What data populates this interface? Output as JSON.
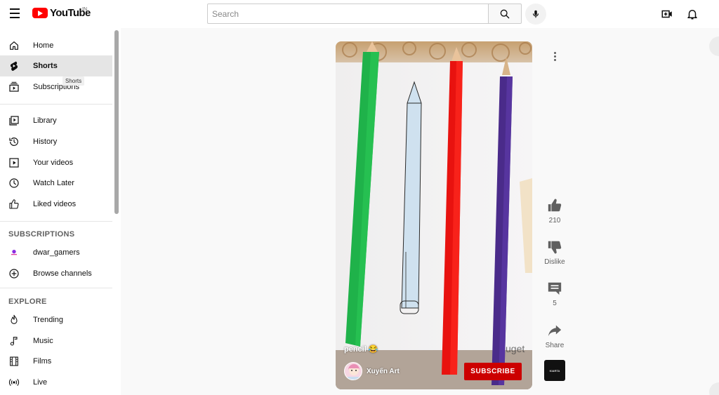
{
  "header": {
    "menu_icon": "hamburger-icon",
    "logo_text": "YouTube",
    "country_code": "IN",
    "search_placeholder": "Search",
    "search_icon": "search-icon",
    "mic_icon": "mic-icon",
    "create_icon": "create-video-icon",
    "notifications_icon": "bell-icon"
  },
  "sidebar": {
    "main": [
      {
        "label": "Home",
        "icon": "home-icon"
      },
      {
        "label": "Shorts",
        "icon": "shorts-icon",
        "active": true
      },
      {
        "label": "Subscriptions",
        "icon": "subscriptions-icon"
      }
    ],
    "tooltip": "Shorts",
    "library": [
      {
        "label": "Library",
        "icon": "library-icon"
      },
      {
        "label": "History",
        "icon": "history-icon"
      },
      {
        "label": "Your videos",
        "icon": "your-videos-icon"
      },
      {
        "label": "Watch Later",
        "icon": "clock-icon"
      },
      {
        "label": "Liked videos",
        "icon": "thumbs-up-icon"
      }
    ],
    "subscriptions_title": "SUBSCRIPTIONS",
    "subscriptions": [
      {
        "label": "dwar_gamers",
        "icon": "channel-avatar"
      },
      {
        "label": "Browse channels",
        "icon": "plus-circle-icon"
      }
    ],
    "explore_title": "EXPLORE",
    "explore": [
      {
        "label": "Trending",
        "icon": "flame-icon"
      },
      {
        "label": "Music",
        "icon": "music-note-icon"
      },
      {
        "label": "Films",
        "icon": "film-icon"
      },
      {
        "label": "Live",
        "icon": "live-icon"
      }
    ]
  },
  "short": {
    "title": "pencil 😂",
    "channel_name": "Xuyến Art",
    "subscribe_label": "SUBSCRIBE",
    "more_icon": "more-vert-icon"
  },
  "actions": {
    "like_count": "210",
    "dislike_label": "Dislike",
    "comment_count": "5",
    "share_label": "Share",
    "audio_tile_text": "KIARTA"
  }
}
